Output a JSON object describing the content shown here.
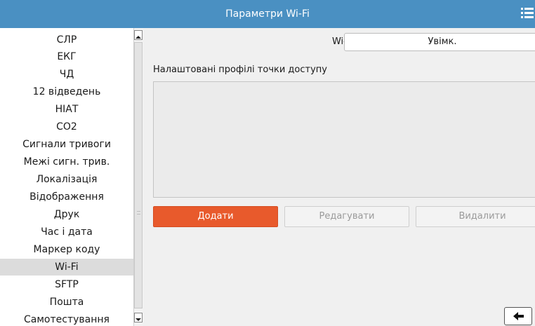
{
  "header": {
    "title": "Параметри Wi-Fi",
    "menu_icon": "list-menu-icon"
  },
  "sidebar": {
    "items": [
      {
        "label": "СЛР"
      },
      {
        "label": "ЕКГ"
      },
      {
        "label": "ЧД"
      },
      {
        "label": "12 відведень"
      },
      {
        "label": "НІАТ"
      },
      {
        "label": "CO2"
      },
      {
        "label": "Сигнали тривоги"
      },
      {
        "label": "Межі сигн. трив."
      },
      {
        "label": "Локалізація"
      },
      {
        "label": "Відображення"
      },
      {
        "label": "Друк"
      },
      {
        "label": "Час і дата"
      },
      {
        "label": "Маркер коду"
      },
      {
        "label": "Wi-Fi",
        "selected": true
      },
      {
        "label": "SFTP"
      },
      {
        "label": "Пошта"
      },
      {
        "label": "Самотестування"
      }
    ]
  },
  "main": {
    "wifi_label": "Wi-Fi",
    "wifi_value": "Увімк.",
    "profiles_label": "Налаштовані профілі точки доступу",
    "buttons": {
      "add": "Додати",
      "edit": "Редагувати",
      "delete": "Видалити"
    },
    "back_icon": "back-arrow-icon"
  },
  "colors": {
    "titlebar": "#4a90c2",
    "accent": "#e85a2c",
    "selected_row": "#dcdcdc",
    "content_bg": "#f0f0f0"
  }
}
